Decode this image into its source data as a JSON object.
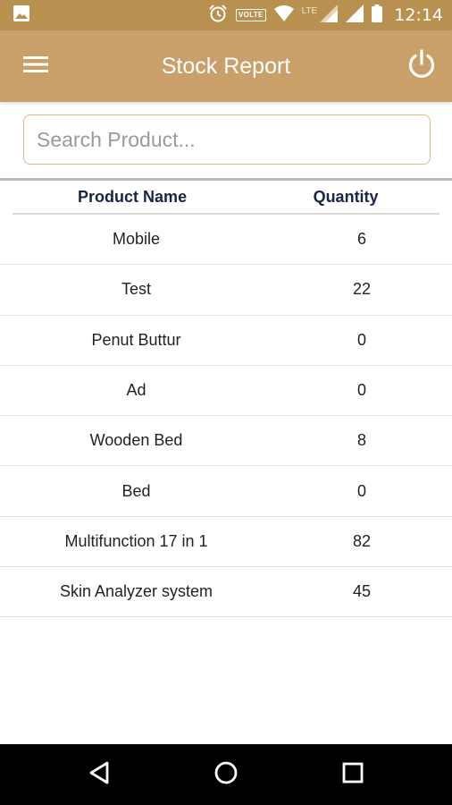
{
  "status_bar": {
    "time": "12:14",
    "volte_label": "VOLTE",
    "lte_label": "LTE",
    "icons": [
      "image-icon",
      "alarm-icon",
      "wifi-icon",
      "signal-icon",
      "signal-icon",
      "battery-icon"
    ]
  },
  "app_bar": {
    "title": "Stock Report",
    "left_icon": "menu-icon",
    "right_icon": "power-icon"
  },
  "search": {
    "placeholder": "Search Product...",
    "value": ""
  },
  "table": {
    "headers": {
      "name": "Product Name",
      "quantity": "Quantity"
    },
    "rows": [
      {
        "name": "Mobile",
        "quantity": "6"
      },
      {
        "name": "Test",
        "quantity": "22"
      },
      {
        "name": "Penut Buttur",
        "quantity": "0"
      },
      {
        "name": "Ad",
        "quantity": "0"
      },
      {
        "name": "Wooden Bed",
        "quantity": "8"
      },
      {
        "name": "Bed",
        "quantity": "0"
      },
      {
        "name": "Multifunction 17 in 1",
        "quantity": "82"
      },
      {
        "name": "Skin Analyzer system",
        "quantity": "45"
      }
    ]
  },
  "nav_bar": {
    "icons": [
      "back-icon",
      "home-icon",
      "recents-icon"
    ]
  },
  "colors": {
    "status_bar": "#b8904f",
    "app_bar": "#c9a06a",
    "header_text": "#1a2546",
    "search_border": "#d8b98c"
  }
}
